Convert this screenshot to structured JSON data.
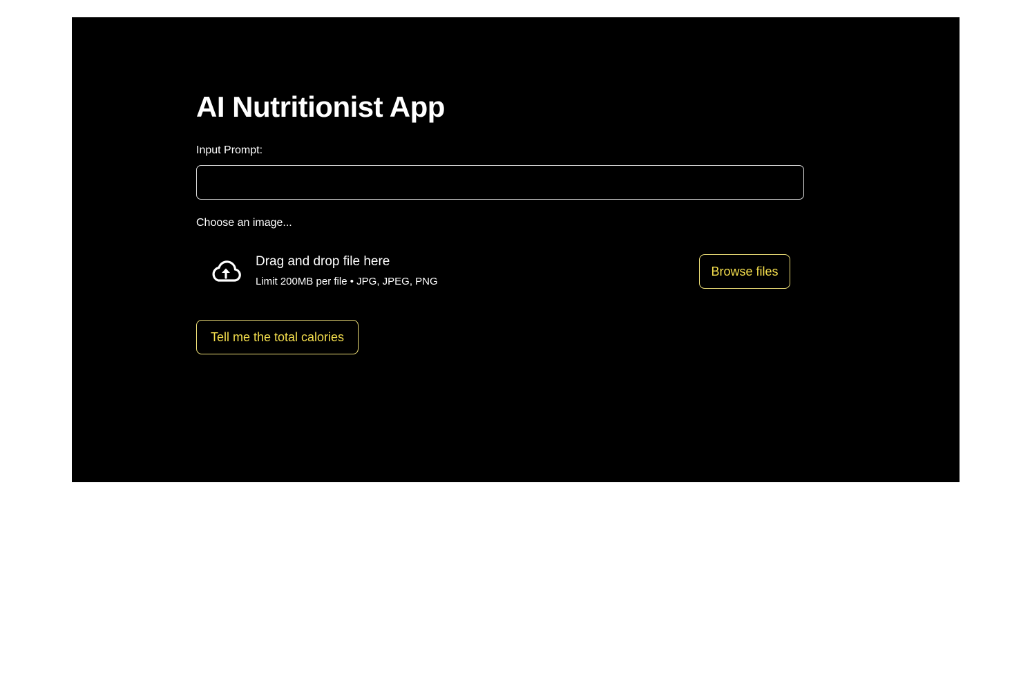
{
  "app": {
    "title": "AI Nutritionist App"
  },
  "prompt": {
    "label": "Input Prompt:",
    "value": "",
    "placeholder": ""
  },
  "uploader": {
    "label": "Choose an image...",
    "dropzone_title": "Drag and drop file here",
    "dropzone_hint": "Limit 200MB per file • JPG, JPEG, PNG",
    "browse_label": "Browse files",
    "icon": "cloud-upload-icon"
  },
  "submit": {
    "label": "Tell me the total calories"
  },
  "colors": {
    "background": "#000000",
    "text": "#ffffff",
    "accent": "#f5df4d",
    "page": "#ffffff"
  }
}
